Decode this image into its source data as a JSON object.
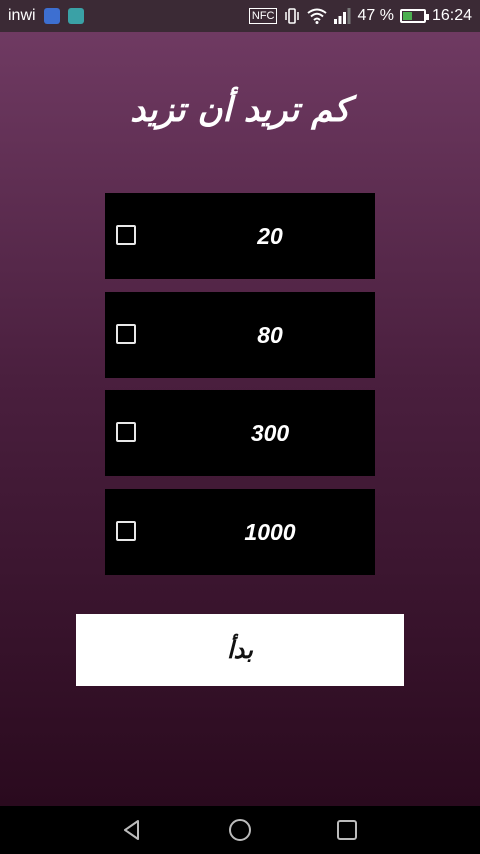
{
  "status_bar": {
    "carrier": "inwi",
    "nfc": "NFC",
    "battery_percent": "47 %",
    "time": "16:24",
    "battery_level": 0.47
  },
  "screen": {
    "title": "كم تريد أن تزيد",
    "options": [
      {
        "label": "20",
        "checked": false
      },
      {
        "label": "80",
        "checked": false
      },
      {
        "label": "300",
        "checked": false
      },
      {
        "label": "1000",
        "checked": false
      }
    ],
    "start_button": "بدأ"
  },
  "colors": {
    "gradient_top": "#6f3a62",
    "gradient_bottom": "#2a0a1e",
    "option_bg": "#000000",
    "button_bg": "#ffffff"
  },
  "nav_bar": {
    "icons": [
      "back-icon",
      "home-icon",
      "recents-icon"
    ]
  }
}
